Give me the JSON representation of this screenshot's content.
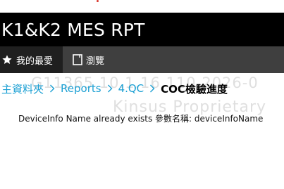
{
  "app": {
    "title": "K1&K2 MES RPT"
  },
  "nav": {
    "items": [
      {
        "label": "我的最愛",
        "icon": "star-icon",
        "active": true
      },
      {
        "label": "瀏覽",
        "icon": "document-icon",
        "active": false
      }
    ]
  },
  "breadcrumb": {
    "items": [
      "主資料夾",
      "Reports",
      "4.QC"
    ],
    "current": "COC檢驗進度"
  },
  "watermark": {
    "line1": "G11365 10.1.16.110 2026-0",
    "line2": "Kinsus Proprietary"
  },
  "message": {
    "text": "DeviceInfo Name already exists 參數名稱: deviceInfoName"
  },
  "colors": {
    "title_bar": "#000000",
    "nav_bar": "#3f3f3f",
    "nav_active": "#1f1f1f",
    "link": "#1a9fd3"
  }
}
